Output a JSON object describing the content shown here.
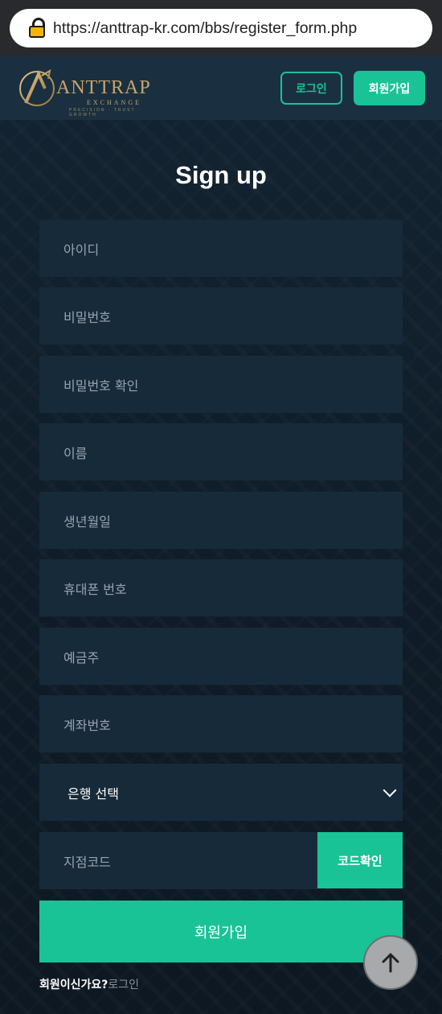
{
  "browser": {
    "url": "https://anttrap-kr.com/bbs/register_form.php"
  },
  "header": {
    "logo": {
      "name": "ANTTRAP",
      "sub": "EXCHANGE",
      "tagline": "PRECISION · TRUST · GROWTH"
    },
    "login_label": "로그인",
    "register_label": "회원가입"
  },
  "form": {
    "title": "Sign up",
    "fields": [
      {
        "placeholder": "아이디"
      },
      {
        "placeholder": "비밀번호"
      },
      {
        "placeholder": "비밀번호 확인"
      },
      {
        "placeholder": "이름"
      },
      {
        "placeholder": "생년월일"
      },
      {
        "placeholder": "휴대폰 번호"
      },
      {
        "placeholder": "예금주"
      },
      {
        "placeholder": "계좌번호"
      }
    ],
    "bank_select": {
      "selected": "은행 선택"
    },
    "branch_code": {
      "placeholder": "지점코드",
      "check_label": "코드확인"
    },
    "submit_label": "회원가입",
    "member_question": "회원이신가요?",
    "member_login_link": "로그인"
  },
  "colors": {
    "accent": "#19c396",
    "background": "#0f1d29",
    "field": "#162a3a",
    "logo_gold": "#c9a46a"
  }
}
